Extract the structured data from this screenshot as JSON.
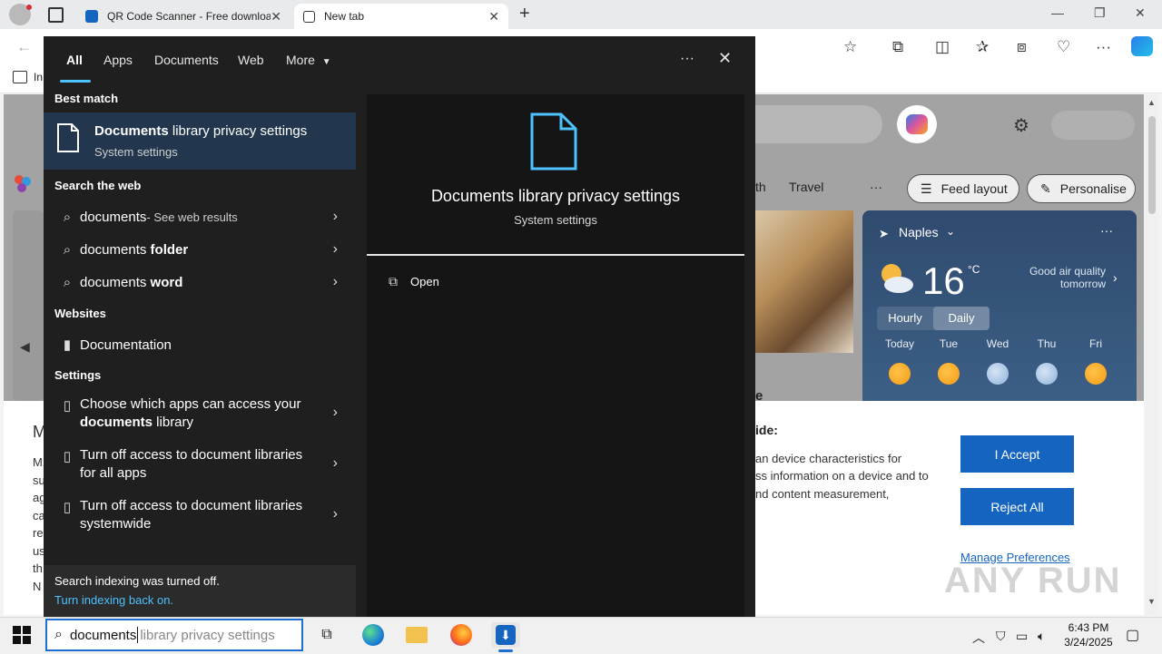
{
  "browser": {
    "tabs": [
      {
        "title": "QR Code Scanner - Free downloa"
      },
      {
        "title": "New tab"
      }
    ],
    "new_tab_symbol": "+",
    "close_symbol": "✕",
    "favorites_bar_visible_text": "In"
  },
  "page": {
    "nav_items": [
      "th",
      "Travel"
    ],
    "more_dots": "···",
    "buttons": {
      "feed_layout": "Feed layout",
      "personalise": "Personalise"
    },
    "weather": {
      "city": "Naples",
      "temp": "16",
      "unit": "°C",
      "air_quality": "Good air quality tomorrow",
      "toggle": [
        "Hourly",
        "Daily"
      ],
      "days": [
        "Today",
        "Tue",
        "Wed",
        "Thu",
        "Fri"
      ],
      "more": "···"
    },
    "headline_fragment": "e",
    "cookie": {
      "heading_fragment": "ide:",
      "lines": [
        "an device characteristics for",
        "ss information on a device and to",
        "nd content measurement,"
      ],
      "left_fragment": "M",
      "left_letters": [
        "M",
        "su",
        "ag",
        "ca",
        "re",
        "us",
        "th",
        "N"
      ],
      "accept": "I Accept",
      "reject": "Reject All",
      "manage": "Manage Preferences"
    },
    "watermark": "ANY RUN"
  },
  "search_panel": {
    "tabs": [
      "All",
      "Apps",
      "Documents",
      "Web",
      "More"
    ],
    "more_menu": "···",
    "close": "✕",
    "best_match_heading": "Best match",
    "best_match": {
      "bold": "Documents",
      "rest": " library privacy settings",
      "subtitle": "System settings"
    },
    "search_web_heading": "Search the web",
    "web_results": [
      {
        "query": "documents",
        "suffix": " - See web results"
      },
      {
        "query": "documents ",
        "bold": "folder"
      },
      {
        "query": "documents ",
        "bold": "word"
      }
    ],
    "websites_heading": "Websites",
    "websites": [
      "Documentation"
    ],
    "settings_heading": "Settings",
    "settings": [
      {
        "line1": "Choose which apps can access your",
        "bold": "documents",
        "line2_rest": " library"
      },
      {
        "line1": "Turn off access to document libraries",
        "line2": "for all apps"
      },
      {
        "line1": "Turn off access to document libraries",
        "line2": "systemwide"
      }
    ],
    "indexing": {
      "text": "Search indexing was turned off.",
      "link": "Turn indexing back on."
    },
    "detail": {
      "title": "Documents library privacy settings",
      "subtitle": "System settings",
      "action": "Open"
    }
  },
  "taskbar": {
    "search_typed": "documents",
    "search_suggest": "library privacy settings",
    "time": "6:43 PM",
    "date": "3/24/2025"
  },
  "colors": {
    "accent": "#4cc2ff",
    "taskbar_search_border": "#1f6fd1",
    "consent_button": "#1565c0"
  }
}
